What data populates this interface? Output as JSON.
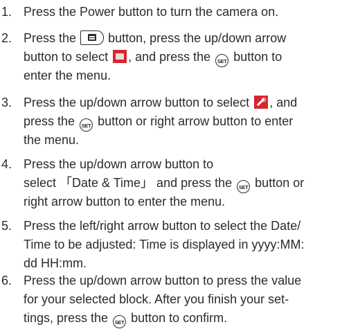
{
  "steps": [
    {
      "number": "1.",
      "line1": "Press the Power button to turn the camera on."
    },
    {
      "number": "2.",
      "line1_a": "Press the",
      "line1_b": "button, press the up/down arrow",
      "line2_a": "button to select",
      "line2_b": ", and press the",
      "line2_c": "button to",
      "line3": "enter the menu."
    },
    {
      "number": "3.",
      "line1_a": "Press the up/down arrow button to select",
      "line1_b": ", and",
      "line2_a": "press the",
      "line2_b": "button or right arrow button to enter",
      "line3": "the menu."
    },
    {
      "number": "4.",
      "line1": "Press the up/down arrow button to",
      "line2_a": "select 「Date & Time」 and press the",
      "line2_b": "button or",
      "line3": "right arrow button to enter the menu."
    },
    {
      "number": "5.",
      "line1": "Press the left/right arrow button to select the Date/",
      "line2": "Time to be adjusted: Time is displayed in yyyy:MM:",
      "line3": "dd HH:mm."
    },
    {
      "number": "6.",
      "line1": "Press the up/down arrow button to press the value",
      "line2": "for your selected block. After you finish your set-",
      "line3_a": "tings, press the",
      "line3_b": "button to confirm."
    }
  ],
  "icons": {
    "set_label": "SET"
  },
  "colors": {
    "text": "#2b2b2b",
    "icon_red": "#d6262f"
  }
}
